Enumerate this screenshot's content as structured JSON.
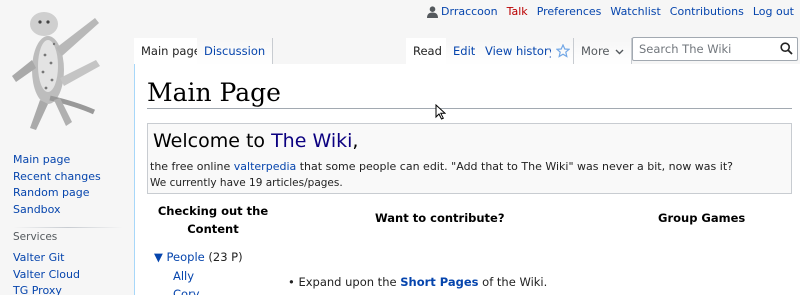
{
  "personal": {
    "username": "Drraccoon",
    "talk": "Talk",
    "preferences": "Preferences",
    "watchlist": "Watchlist",
    "contributions": "Contributions",
    "logout": "Log out"
  },
  "tabs": {
    "main_page": "Main page",
    "discussion": "Discussion",
    "read": "Read",
    "edit": "Edit",
    "view_history": "View history",
    "more": "More"
  },
  "search": {
    "placeholder": "Search The Wiki"
  },
  "page": {
    "title": "Main Page",
    "welcome_prefix": "Welcome to ",
    "welcome_link": "The Wiki",
    "welcome_suffix": ",",
    "line1_prefix": "the free online ",
    "line1_link": "valterpedia",
    "line1_suffix": " that some people can edit. \"Add that to The Wiki\" was never a bit, now was it?",
    "count_line": "We currently have 19 articles/pages.",
    "col1_line1": "Checking out the",
    "col1_line2": "Content",
    "col2": "Want to contribute?",
    "col3": "Group Games",
    "tree_arrow": "▼",
    "tree_people": "People",
    "tree_people_count": "(23 P)",
    "tree_ally": "Ally",
    "tree_next": "Cory",
    "bullet_prefix": "Expand upon the ",
    "bullet_link": "Short Pages",
    "bullet_suffix": " of the Wiki."
  },
  "sidebar": {
    "nav": [
      "Main page",
      "Recent changes",
      "Random page",
      "Sandbox"
    ],
    "services_heading": "Services",
    "services": [
      "Valter Git",
      "Valter Cloud",
      "TG Proxy"
    ]
  },
  "colors": {
    "link": "#0645ad",
    "new_link": "#ba0000",
    "tab_border": "#a7d7f9"
  },
  "icons": {
    "user": "user-icon",
    "star": "watch-star-icon",
    "search": "search-icon",
    "more": "chevron-down-icon"
  }
}
